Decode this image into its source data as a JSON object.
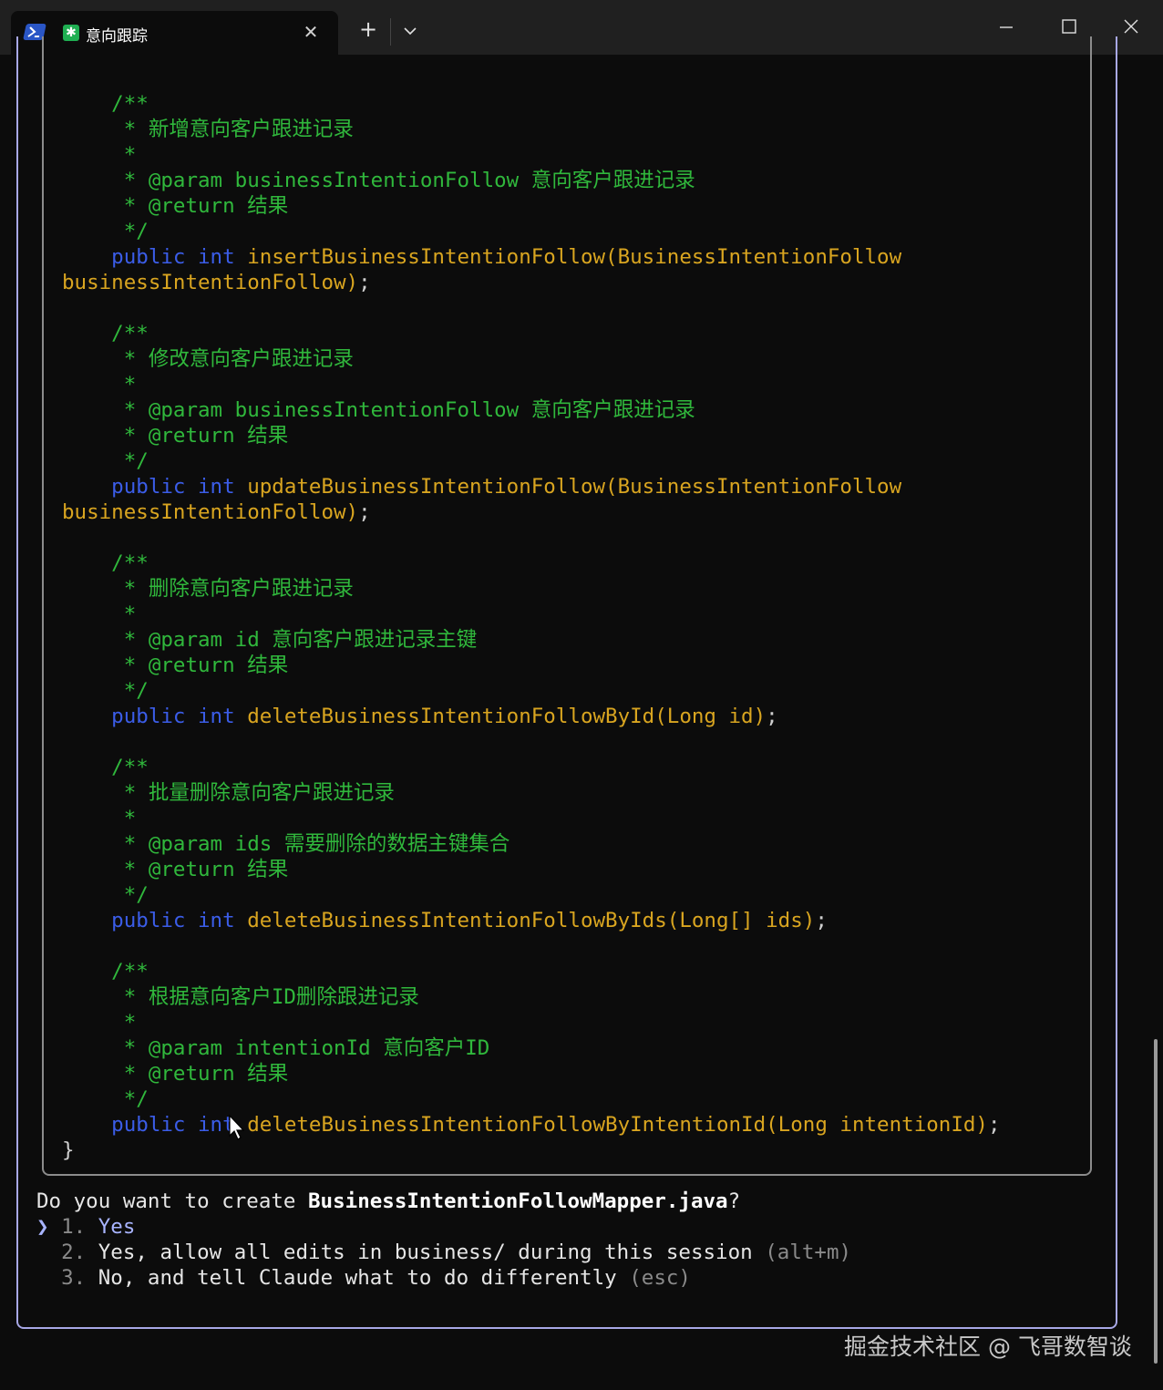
{
  "titlebar": {
    "tab_title": "意向跟踪",
    "tab_close": "✕",
    "new_tab": "+"
  },
  "code_lines": [
    [
      {
        "t": "    /**",
        "c": "c-com"
      }
    ],
    [
      {
        "t": "     * 新增意向客户跟进记录",
        "c": "c-com"
      }
    ],
    [
      {
        "t": "     *",
        "c": "c-com"
      }
    ],
    [
      {
        "t": "     * @param businessIntentionFollow 意向客户跟进记录",
        "c": "c-com"
      }
    ],
    [
      {
        "t": "     * @return 结果",
        "c": "c-com"
      }
    ],
    [
      {
        "t": "     */",
        "c": "c-com"
      }
    ],
    [
      {
        "t": "    public",
        "c": "c-kw"
      },
      {
        "t": " ",
        "c": "c-txt"
      },
      {
        "t": "int",
        "c": "c-kw"
      },
      {
        "t": " insertBusinessIntentionFollow(BusinessIntentionFollow",
        "c": "c-fn"
      }
    ],
    [
      {
        "t": "businessIntentionFollow)",
        "c": "c-fn"
      },
      {
        "t": ";",
        "c": "c-txt"
      }
    ],
    [
      {
        "t": "",
        "c": "c-txt"
      }
    ],
    [
      {
        "t": "    /**",
        "c": "c-com"
      }
    ],
    [
      {
        "t": "     * 修改意向客户跟进记录",
        "c": "c-com"
      }
    ],
    [
      {
        "t": "     *",
        "c": "c-com"
      }
    ],
    [
      {
        "t": "     * @param businessIntentionFollow 意向客户跟进记录",
        "c": "c-com"
      }
    ],
    [
      {
        "t": "     * @return 结果",
        "c": "c-com"
      }
    ],
    [
      {
        "t": "     */",
        "c": "c-com"
      }
    ],
    [
      {
        "t": "    public",
        "c": "c-kw"
      },
      {
        "t": " ",
        "c": "c-txt"
      },
      {
        "t": "int",
        "c": "c-kw"
      },
      {
        "t": " updateBusinessIntentionFollow(BusinessIntentionFollow",
        "c": "c-fn"
      }
    ],
    [
      {
        "t": "businessIntentionFollow)",
        "c": "c-fn"
      },
      {
        "t": ";",
        "c": "c-txt"
      }
    ],
    [
      {
        "t": "",
        "c": "c-txt"
      }
    ],
    [
      {
        "t": "    /**",
        "c": "c-com"
      }
    ],
    [
      {
        "t": "     * 删除意向客户跟进记录",
        "c": "c-com"
      }
    ],
    [
      {
        "t": "     *",
        "c": "c-com"
      }
    ],
    [
      {
        "t": "     * @param id 意向客户跟进记录主键",
        "c": "c-com"
      }
    ],
    [
      {
        "t": "     * @return 结果",
        "c": "c-com"
      }
    ],
    [
      {
        "t": "     */",
        "c": "c-com"
      }
    ],
    [
      {
        "t": "    public",
        "c": "c-kw"
      },
      {
        "t": " ",
        "c": "c-txt"
      },
      {
        "t": "int",
        "c": "c-kw"
      },
      {
        "t": " deleteBusinessIntentionFollowById(Long id)",
        "c": "c-fn"
      },
      {
        "t": ";",
        "c": "c-txt"
      }
    ],
    [
      {
        "t": "",
        "c": "c-txt"
      }
    ],
    [
      {
        "t": "    /**",
        "c": "c-com"
      }
    ],
    [
      {
        "t": "     * 批量删除意向客户跟进记录",
        "c": "c-com"
      }
    ],
    [
      {
        "t": "     *",
        "c": "c-com"
      }
    ],
    [
      {
        "t": "     * @param ids 需要删除的数据主键集合",
        "c": "c-com"
      }
    ],
    [
      {
        "t": "     * @return 结果",
        "c": "c-com"
      }
    ],
    [
      {
        "t": "     */",
        "c": "c-com"
      }
    ],
    [
      {
        "t": "    public",
        "c": "c-kw"
      },
      {
        "t": " ",
        "c": "c-txt"
      },
      {
        "t": "int",
        "c": "c-kw"
      },
      {
        "t": " deleteBusinessIntentionFollowByIds(Long[] ids)",
        "c": "c-fn"
      },
      {
        "t": ";",
        "c": "c-txt"
      }
    ],
    [
      {
        "t": "",
        "c": "c-txt"
      }
    ],
    [
      {
        "t": "    /**",
        "c": "c-com"
      }
    ],
    [
      {
        "t": "     * 根据意向客户ID删除跟进记录",
        "c": "c-com"
      }
    ],
    [
      {
        "t": "     *",
        "c": "c-com"
      }
    ],
    [
      {
        "t": "     * @param intentionId 意向客户ID",
        "c": "c-com"
      }
    ],
    [
      {
        "t": "     * @return 结果",
        "c": "c-com"
      }
    ],
    [
      {
        "t": "     */",
        "c": "c-com"
      }
    ],
    [
      {
        "t": "    public",
        "c": "c-kw"
      },
      {
        "t": " ",
        "c": "c-txt"
      },
      {
        "t": "int",
        "c": "c-kw"
      },
      {
        "t": " deleteBusinessIntentionFollowByIntentionId(Long intentionId)",
        "c": "c-fn"
      },
      {
        "t": ";",
        "c": "c-txt"
      }
    ],
    [
      {
        "t": "}",
        "c": "c-txt"
      }
    ]
  ],
  "prompt": {
    "question_prefix": "Do you want to create ",
    "question_file": "BusinessIntentionFollowMapper.java",
    "question_suffix": "?",
    "pointer": "❯",
    "options": [
      {
        "num": "1.",
        "label": "Yes",
        "hint": ""
      },
      {
        "num": "2.",
        "label": "Yes, allow all edits in business/ during this session",
        "hint": "(alt+m)"
      },
      {
        "num": "3.",
        "label": "No, and tell Claude what to do differently",
        "hint": "(esc)"
      }
    ]
  },
  "watermark": "掘金技术社区 @ 飞哥数智谈",
  "icons": [
    "powershell-icon",
    "tab-app-icon",
    "close-icon",
    "plus-icon",
    "chevron-down-icon",
    "minimize-icon",
    "maximize-icon",
    "window-close-icon",
    "mouse-cursor-icon"
  ],
  "colors": {
    "comment": "#30b83c",
    "keyword": "#3b5de8",
    "function": "#d9a520",
    "selected": "#a8b4ff",
    "border": "#a8a8e6"
  }
}
